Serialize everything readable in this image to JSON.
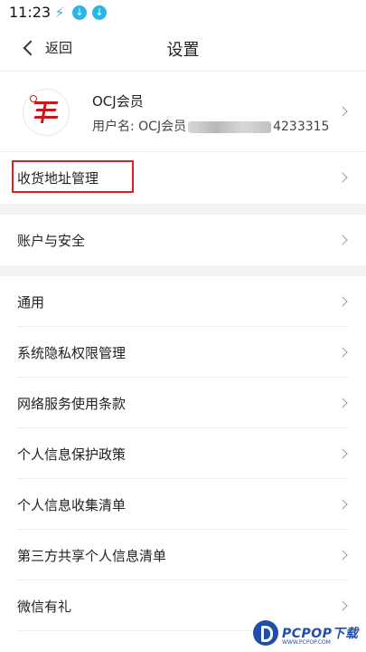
{
  "status": {
    "time": "11:23"
  },
  "nav": {
    "back_label": "返回",
    "title": "设置"
  },
  "profile": {
    "name": "OCJ会员",
    "username_prefix": "用户名: OCJ会员",
    "username_suffix": "4233315"
  },
  "menu": [
    {
      "label": "收货地址管理"
    },
    {
      "label": "账户与安全"
    },
    {
      "label": "通用"
    },
    {
      "label": "系统隐私权限管理"
    },
    {
      "label": "网络服务使用条款"
    },
    {
      "label": "个人信息保护政策"
    },
    {
      "label": "个人信息收集清单"
    },
    {
      "label": "第三方共享个人信息清单"
    },
    {
      "label": "微信有礼"
    }
  ],
  "watermark": {
    "text": "PCPOP下载",
    "url": "WWW.PCPOP.COM"
  },
  "colors": {
    "accent": "#29b6e6",
    "highlight": "#e02020",
    "watermark": "#1f4fa8"
  }
}
